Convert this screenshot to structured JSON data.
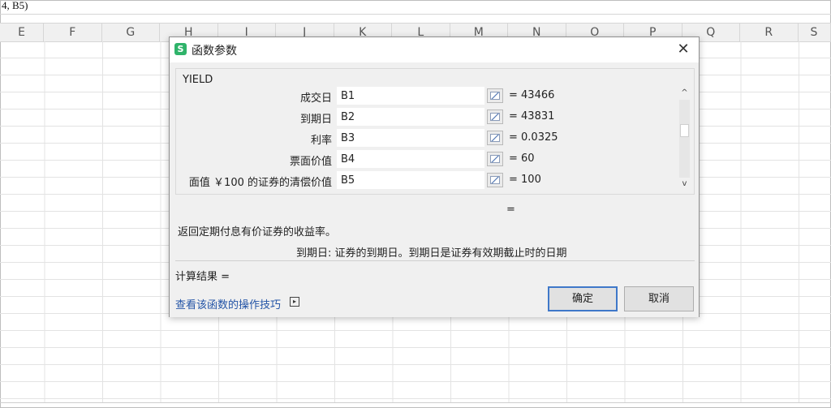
{
  "formula_bar": {
    "text": "4, B5)"
  },
  "columns": [
    "E",
    "F",
    "G",
    "H",
    "I",
    "J",
    "K",
    "L",
    "M",
    "N",
    "O",
    "P",
    "Q",
    "R",
    "S"
  ],
  "dialog": {
    "title": "函数参数",
    "app_icon_letter": "S",
    "close_glyph": "✕",
    "function_name": "YIELD",
    "arguments": [
      {
        "label": "成交日",
        "value": "B1",
        "result": "= 43466"
      },
      {
        "label": "到期日",
        "value": "B2",
        "result": "= 43831"
      },
      {
        "label": "利率",
        "value": "B3",
        "result": "= 0.0325"
      },
      {
        "label": "票面价值",
        "value": "B4",
        "result": "= 60"
      },
      {
        "label": "面值 ￥100 的证券的清偿价值",
        "value": "B5",
        "result": "= 100"
      }
    ],
    "formula_result_eq": "=",
    "description": "返回定期付息有价证券的收益率。",
    "arg_description": "到期日:  证券的到期日。到期日是证券有效期截止时的日期",
    "calc_result": "计算结果 =",
    "help_link": "查看该函数的操作技巧",
    "ok_label": "确定",
    "cancel_label": "取消",
    "scroll_up": "^",
    "scroll_down": "v"
  }
}
